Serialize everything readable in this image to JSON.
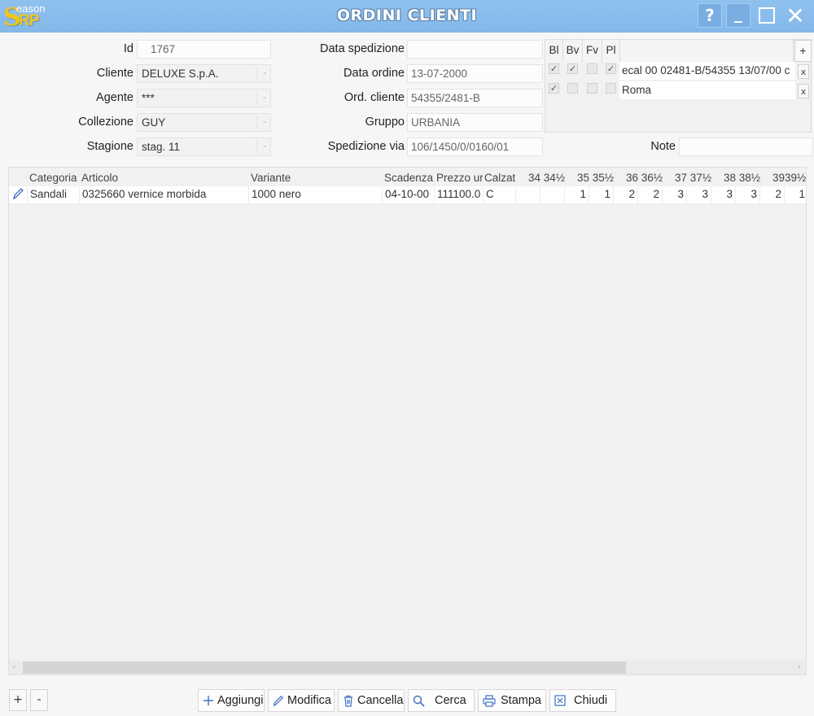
{
  "window": {
    "title": "ORDINI CLIENTI",
    "logo": {
      "s": "S",
      "eason": "eason",
      "rp": "RP"
    },
    "controls": {
      "help": "?",
      "minimize": "_",
      "maximize": "☐",
      "close": "✕"
    }
  },
  "form": {
    "id": {
      "label": "Id",
      "value": "1767"
    },
    "cliente": {
      "label": "Cliente",
      "value": "DELUXE S.p.A."
    },
    "agente": {
      "label": "Agente",
      "value": "***"
    },
    "collezione": {
      "label": "Collezione",
      "value": "GUY"
    },
    "stagione": {
      "label": "Stagione",
      "value": "stag. 11"
    },
    "data_spedizione": {
      "label": "Data spedizione",
      "value": ""
    },
    "data_ordine": {
      "label": "Data ordine",
      "value": "13-07-2000"
    },
    "ord_cliente": {
      "label": "Ord. cliente",
      "value": "54355/2481-B"
    },
    "gruppo": {
      "label": "Gruppo",
      "value": "URBANIA"
    },
    "spedizione_via": {
      "label": "Spedizione via",
      "value": "106/1450/0/0160/01"
    },
    "note": {
      "label": "Note",
      "value": ""
    }
  },
  "doc_panel": {
    "headers": [
      "Bl",
      "Bv",
      "Fv",
      "Pl"
    ],
    "add_label": "+",
    "rows": [
      {
        "bl": true,
        "bv": true,
        "fv": false,
        "pl": true,
        "text": "ecal 00 02481-B/54355 13/07/00 c",
        "remove": "x"
      },
      {
        "bl": true,
        "bv": false,
        "fv": false,
        "pl": false,
        "text": "Roma",
        "remove": "x"
      }
    ]
  },
  "grid": {
    "headers": {
      "categoria": "Categoria",
      "articolo": "Articolo",
      "variante": "Variante",
      "scadenza": "Scadenza",
      "prezzo": "Prezzo ur",
      "calzata": "Calzat",
      "sizes": [
        "34",
        "34½",
        "35",
        "35½",
        "36",
        "36½",
        "37",
        "37½",
        "38",
        "38½",
        "39",
        "39½"
      ]
    },
    "rows": [
      {
        "categoria": "Sandali",
        "articolo": "0325660 vernice morbida",
        "variante": "1000 nero",
        "scadenza": "04-10-00",
        "prezzo": "111100.0",
        "calzata": "C",
        "sizes": [
          "",
          "",
          "1",
          "1",
          "2",
          "2",
          "3",
          "3",
          "3",
          "3",
          "2",
          "1"
        ]
      }
    ]
  },
  "footer": {
    "plus": "+",
    "minus": "-",
    "aggiungi": "Aggiungi",
    "modifica": "Modifica",
    "cancella": "Cancella",
    "cerca": "Cerca",
    "stampa": "Stampa",
    "chiudi": "Chiudi"
  }
}
